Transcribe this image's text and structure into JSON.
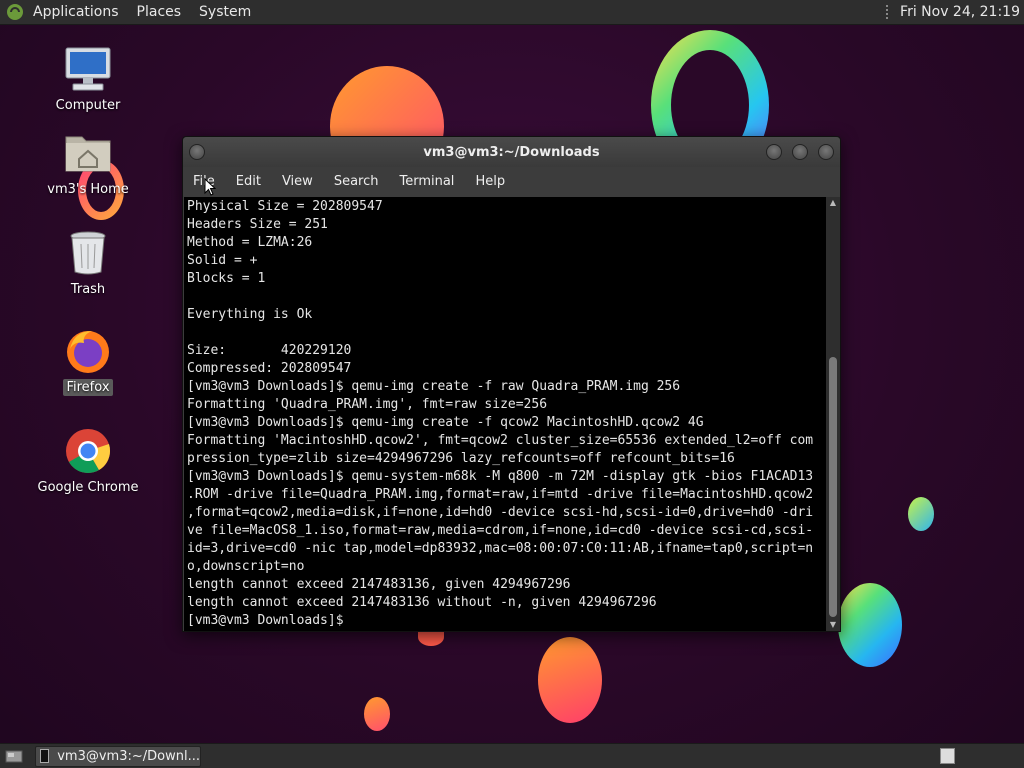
{
  "top_panel": {
    "menus": [
      "Applications",
      "Places",
      "System"
    ],
    "clock": "Fri Nov 24, 21:19"
  },
  "desktop": {
    "icons": [
      {
        "label": "Computer",
        "icon": "computer-icon"
      },
      {
        "label": "vm3's Home",
        "icon": "home-folder-icon"
      },
      {
        "label": "Trash",
        "icon": "trash-icon"
      },
      {
        "label": "Firefox",
        "icon": "firefox-icon"
      },
      {
        "label": "Google Chrome",
        "icon": "chrome-icon"
      }
    ]
  },
  "terminal": {
    "title": "vm3@vm3:~/Downloads",
    "menu": [
      "File",
      "Edit",
      "View",
      "Search",
      "Terminal",
      "Help"
    ],
    "lines": [
      "Physical Size = 202809547",
      "Headers Size = 251",
      "Method = LZMA:26",
      "Solid = +",
      "Blocks = 1",
      "",
      "Everything is Ok",
      "",
      "Size:       420229120",
      "Compressed: 202809547",
      "[vm3@vm3 Downloads]$ qemu-img create -f raw Quadra_PRAM.img 256",
      "Formatting 'Quadra_PRAM.img', fmt=raw size=256",
      "[vm3@vm3 Downloads]$ qemu-img create -f qcow2 MacintoshHD.qcow2 4G",
      "Formatting 'MacintoshHD.qcow2', fmt=qcow2 cluster_size=65536 extended_l2=off com",
      "pression_type=zlib size=4294967296 lazy_refcounts=off refcount_bits=16",
      "[vm3@vm3 Downloads]$ qemu-system-m68k -M q800 -m 72M -display gtk -bios F1ACAD13",
      ".ROM -drive file=Quadra_PRAM.img,format=raw,if=mtd -drive file=MacintoshHD.qcow2",
      ",format=qcow2,media=disk,if=none,id=hd0 -device scsi-hd,scsi-id=0,drive=hd0 -dri",
      "ve file=MacOS8_1.iso,format=raw,media=cdrom,if=none,id=cd0 -device scsi-cd,scsi-",
      "id=3,drive=cd0 -nic tap,model=dp83932,mac=08:00:07:C0:11:AB,ifname=tap0,script=n",
      "o,downscript=no",
      "length cannot exceed 2147483136, given 4294967296",
      "length cannot exceed 2147483136 without -n, given 4294967296",
      "[vm3@vm3 Downloads]$ "
    ]
  },
  "taskbar": {
    "task_label": "vm3@vm3:~/Downl..."
  }
}
